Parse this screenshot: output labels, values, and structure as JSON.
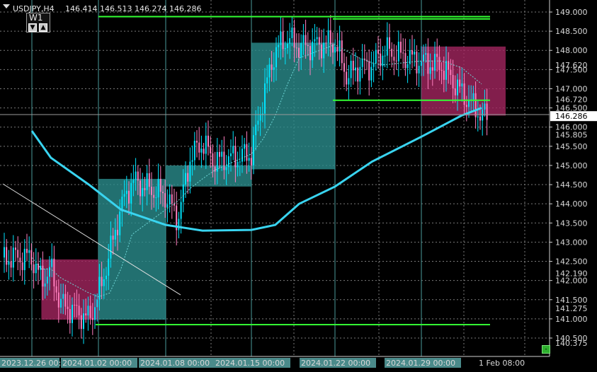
{
  "header": {
    "symbol_timeframe": "USDJPY,H4",
    "ohlc": "146.414 146.513 146.274 146.286"
  },
  "timeframe_panel": {
    "label": "W1",
    "down_arrow": "▼",
    "up_arrow": "▲"
  },
  "corner_button": "-",
  "colors": {
    "background": "#000000",
    "candle_up": "#00e5ff",
    "candle_down": "#ff7fbf",
    "ma_slow": "#39d4f0",
    "ma_fast": "#6fd8d8",
    "level_line": "#33ff33",
    "zone_demand": "#2a8c8c",
    "zone_supply": "#a3265f",
    "grid": "#7a7a7a",
    "session_line": "#4a9a9a"
  },
  "price_axis": {
    "ticks": [
      "149.000",
      "148.500",
      "148.000",
      "147.500",
      "147.000",
      "146.500",
      "146.000",
      "145.500",
      "145.000",
      "144.500",
      "144.000",
      "143.500",
      "143.000",
      "142.500",
      "142.000",
      "141.500",
      "141.000",
      "140.500"
    ],
    "extra_labels": [
      "147.620",
      "146.720",
      "145.805",
      "142.190",
      "141.275",
      "140.375"
    ],
    "current_price": "146.286"
  },
  "time_axis": {
    "labels": [
      "2023.12.26 00:00",
      "2024.01.02 00:00",
      "2024.01.08 00:00",
      "2024.01.15 00:00",
      "2024.01.22 00:00",
      "2024.01.29 00:00",
      "1 Feb 08:00"
    ]
  },
  "chart_data": {
    "type": "candlestick",
    "title": "USDJPY,H4",
    "ylim": [
      140.25,
      149.2
    ],
    "last_close": 146.286,
    "levels": [
      148.88,
      148.82,
      146.7,
      140.85
    ],
    "zones": [
      {
        "kind": "supply",
        "from": "2023.12.27",
        "to": "2024.01.02",
        "low": 140.98,
        "high": 142.55
      },
      {
        "kind": "demand",
        "from": "2024.01.02",
        "to": "2024.01.08",
        "low": 140.98,
        "high": 144.65
      },
      {
        "kind": "demand",
        "from": "2024.01.08",
        "to": "2024.01.15",
        "low": 144.45,
        "high": 145.0
      },
      {
        "kind": "demand",
        "from": "2024.01.15",
        "to": "2024.01.22",
        "low": 144.9,
        "high": 148.2
      },
      {
        "kind": "supply",
        "from": "2024.01.29",
        "to": "2024.02.01",
        "low": 146.3,
        "high": 148.1
      }
    ],
    "session_separators": [
      "2023.12.26",
      "2024.01.02",
      "2024.01.08",
      "2024.01.15",
      "2024.01.22",
      "2024.01.29"
    ],
    "slow_ma": [
      {
        "x": "2023.12.26",
        "y": 145.9
      },
      {
        "x": "2023.12.28",
        "y": 145.2
      },
      {
        "x": "2024.01.01",
        "y": 144.5
      },
      {
        "x": "2024.01.04",
        "y": 143.85
      },
      {
        "x": "2024.01.08",
        "y": 143.45
      },
      {
        "x": "2024.01.11",
        "y": 143.3
      },
      {
        "x": "2024.01.15",
        "y": 143.32
      },
      {
        "x": "2024.01.17",
        "y": 143.45
      },
      {
        "x": "2024.01.19",
        "y": 144.0
      },
      {
        "x": "2024.01.22",
        "y": 144.45
      },
      {
        "x": "2024.01.25",
        "y": 145.1
      },
      {
        "x": "2024.01.29",
        "y": 145.75
      },
      {
        "x": "2024.01.31",
        "y": 146.3
      },
      {
        "x": "2024.02.01",
        "y": 146.5
      }
    ],
    "close_path": [
      {
        "x": "2023.12.26",
        "y": 142.6
      },
      {
        "x": "2023.12.27",
        "y": 142.0
      },
      {
        "x": "2023.12.28",
        "y": 142.3
      },
      {
        "x": "2023.12.29",
        "y": 141.4
      },
      {
        "x": "2024.01.01",
        "y": 141.0
      },
      {
        "x": "2024.01.02",
        "y": 141.6
      },
      {
        "x": "2024.01.03",
        "y": 142.7
      },
      {
        "x": "2024.01.04",
        "y": 143.9
      },
      {
        "x": "2024.01.05",
        "y": 144.6
      },
      {
        "x": "2024.01.08",
        "y": 144.2
      },
      {
        "x": "2024.01.09",
        "y": 143.6
      },
      {
        "x": "2024.01.10",
        "y": 145.2
      },
      {
        "x": "2024.01.11",
        "y": 145.6
      },
      {
        "x": "2024.01.12",
        "y": 145.1
      },
      {
        "x": "2024.01.15",
        "y": 145.3
      },
      {
        "x": "2024.01.16",
        "y": 146.8
      },
      {
        "x": "2024.01.17",
        "y": 148.0
      },
      {
        "x": "2024.01.18",
        "y": 148.3
      },
      {
        "x": "2024.01.19",
        "y": 148.1
      },
      {
        "x": "2024.01.22",
        "y": 148.2
      },
      {
        "x": "2024.01.23",
        "y": 147.3
      },
      {
        "x": "2024.01.24",
        "y": 147.6
      },
      {
        "x": "2024.01.25",
        "y": 147.6
      },
      {
        "x": "2024.01.26",
        "y": 148.0
      },
      {
        "x": "2024.01.29",
        "y": 147.7
      },
      {
        "x": "2024.01.30",
        "y": 147.6
      },
      {
        "x": "2024.01.31",
        "y": 146.9
      },
      {
        "x": "2024.02.01",
        "y": 146.3
      }
    ]
  }
}
